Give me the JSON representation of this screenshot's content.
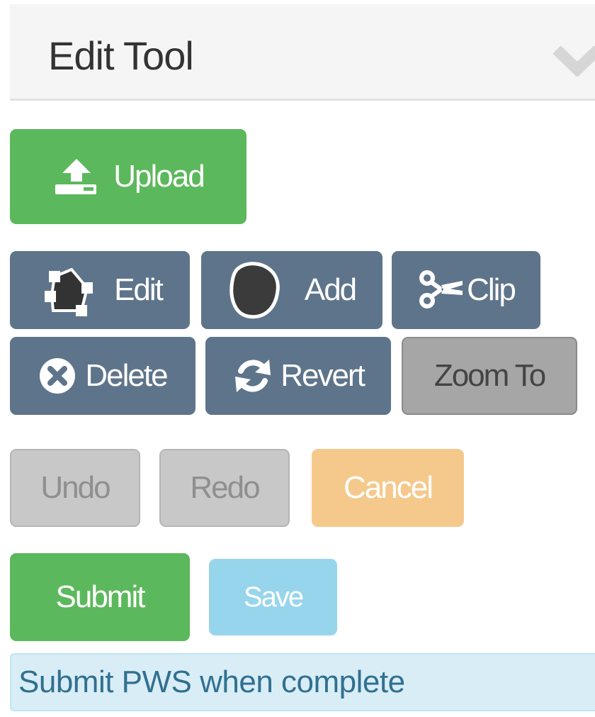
{
  "panel": {
    "title": "Edit Tool",
    "collapse_icon": "chevron-down-icon"
  },
  "toolbar": {
    "upload_label": "Upload",
    "edit_label": "Edit",
    "add_label": "Add",
    "clip_label": "Clip",
    "delete_label": "Delete",
    "revert_label": "Revert",
    "zoom_to_label": "Zoom To",
    "undo_label": "Undo",
    "redo_label": "Redo",
    "cancel_label": "Cancel",
    "submit_label": "Submit",
    "save_label": "Save"
  },
  "icons": {
    "upload": "upload-icon",
    "edit": "edit-vertices-icon",
    "add": "add-polygon-icon",
    "clip": "scissors-icon",
    "delete": "delete-circle-icon",
    "revert": "refresh-icon"
  },
  "colors": {
    "success": "#5cb85c",
    "tool": "#5e748a",
    "disabled": "#c8c8c8",
    "warning": "#f5c98c",
    "info": "#97d5ec",
    "alert_bg": "#d9edf7",
    "alert_text": "#31708f"
  },
  "status": {
    "message": "Submit PWS when complete"
  }
}
